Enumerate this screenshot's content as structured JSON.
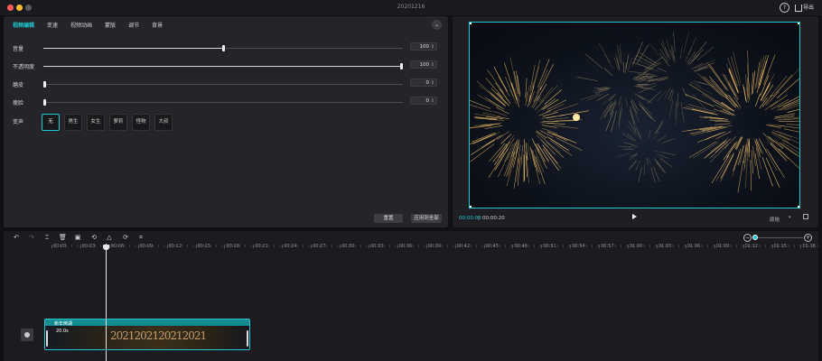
{
  "window": {
    "title": "20201216",
    "help_label": "?",
    "export_label": "导出"
  },
  "editor": {
    "tabs": [
      {
        "label": "视频编辑",
        "active": true
      },
      {
        "label": "变速",
        "active": false
      },
      {
        "label": "视频动画",
        "active": false
      },
      {
        "label": "蒙版",
        "active": false
      },
      {
        "label": "调节",
        "active": false
      },
      {
        "label": "背景",
        "active": false
      }
    ],
    "collapse_icon": "chevron-down-icon",
    "sliders": [
      {
        "label": "音量",
        "value": "100",
        "fraction": 0.5
      },
      {
        "label": "不透明度",
        "value": "100",
        "fraction": 1.0
      },
      {
        "label": "磨皮",
        "value": "0",
        "fraction": 0.0
      },
      {
        "label": "瘦脸",
        "value": "0",
        "fraction": 0.0
      }
    ],
    "voice": {
      "label": "变声",
      "options": [
        "无",
        "男生",
        "女生",
        "萝莉",
        "怪物",
        "大叔"
      ],
      "selected": "无"
    },
    "reset_label": "重置",
    "apply_all_label": "应用到全部"
  },
  "preview": {
    "current_time": "00:00:06",
    "total_time": "00:00:20",
    "ratio_label": "原始",
    "accent": "#22c7d1"
  },
  "timeline": {
    "tools": [
      "undo-icon",
      "redo-icon",
      "split-icon",
      "delete-icon",
      "freeze-icon",
      "reverse-icon",
      "mirror-icon",
      "rotate-icon",
      "crop-icon"
    ],
    "ruler": [
      "00:00",
      "00:03",
      "00:06",
      "00:09",
      "00:12",
      "00:15",
      "00:18",
      "00:21",
      "00:24",
      "00:27",
      "00:30",
      "00:33",
      "00:36",
      "00:39",
      "00:42",
      "00:45",
      "00:48",
      "00:51",
      "00:54",
      "00:57",
      "01:00",
      "01:03",
      "01:06",
      "01:09",
      "01:12",
      "01:15",
      "01:18"
    ],
    "clip": {
      "name": "新年倒湖",
      "duration": "20.0s",
      "thumb_text": "2021202120212021"
    }
  }
}
